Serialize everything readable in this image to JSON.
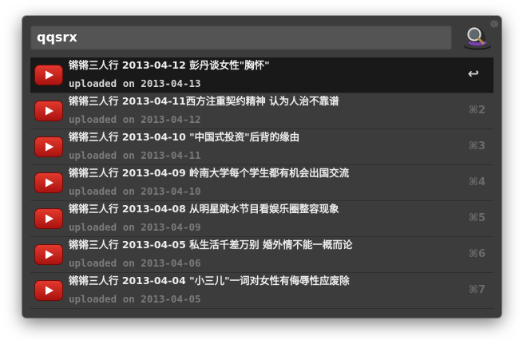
{
  "search": {
    "query": "qqsrx"
  },
  "icons": {
    "app_logo": "alfred-hat-icon",
    "settings": "gear-icon",
    "result": "youtube-play-icon"
  },
  "colors": {
    "background": "#3c3c3c",
    "selected_row": "#191919",
    "youtube_red": "#cc1f1f"
  },
  "results": [
    {
      "title": "锵锵三人行 2013-04-12 彭丹谈女性\"胸怀\"",
      "subtitle": "uploaded on 2013-04-13",
      "shortcut": "↩",
      "selected": true
    },
    {
      "title": "锵锵三人行 2013-04-11西方注重契约精神 认为人治不靠谱",
      "subtitle": "uploaded on 2013-04-12",
      "shortcut": "⌘2",
      "selected": false
    },
    {
      "title": "锵锵三人行 2013-04-10 \"中国式投资\"后背的缘由",
      "subtitle": "uploaded on 2013-04-11",
      "shortcut": "⌘3",
      "selected": false
    },
    {
      "title": "锵锵三人行 2013-04-09 岭南大学每个学生都有机会出国交流",
      "subtitle": "uploaded on 2013-04-10",
      "shortcut": "⌘4",
      "selected": false
    },
    {
      "title": "锵锵三人行 2013-04-08 从明星跳水节目看娱乐圈整容现象",
      "subtitle": "uploaded on 2013-04-09",
      "shortcut": "⌘5",
      "selected": false
    },
    {
      "title": "锵锵三人行 2013-04-05 私生活千差万别 婚外情不能一概而论",
      "subtitle": "uploaded on 2013-04-06",
      "shortcut": "⌘6",
      "selected": false
    },
    {
      "title": "锵锵三人行 2013-04-04 \"小三儿\"一词对女性有侮辱性应废除",
      "subtitle": "uploaded on 2013-04-05",
      "shortcut": "⌘7",
      "selected": false
    }
  ]
}
